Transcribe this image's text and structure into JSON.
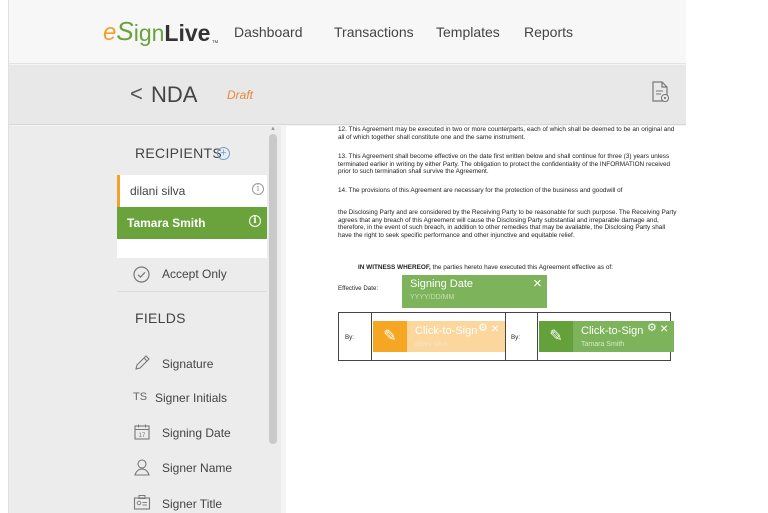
{
  "header": {
    "logo": {
      "e": "e",
      "s": "S",
      "ign": "ign",
      "live": "Live",
      "tm": "™"
    },
    "nav": [
      "Dashboard",
      "Transactions",
      "Templates",
      "Reports"
    ]
  },
  "subheader": {
    "back_symbol": "<",
    "title": "NDA",
    "status": "Draft"
  },
  "sidebar": {
    "recipients_title": "RECIPIENTS",
    "recipients": [
      {
        "name": "dilani silva",
        "color": "#f0a12b"
      },
      {
        "name": "Tamara Smith",
        "color": "#6aa33c"
      }
    ],
    "info_glyph": "i",
    "accept_only_label": "Accept Only",
    "fields_title": "FIELDS",
    "fields": [
      {
        "label": "Signature",
        "icon": "pen-icon"
      },
      {
        "label": "Signer Initials",
        "icon": "TS"
      },
      {
        "label": "Signing Date",
        "icon": "calendar-icon"
      },
      {
        "label": "Signer Name",
        "icon": "person-icon"
      },
      {
        "label": "Signer Title",
        "icon": "title-card-icon"
      }
    ]
  },
  "document": {
    "paragraphs": [
      "12.      This Agreement may be executed in two or more counterparts, each of which shall be deemed to be an original and all of which together shall constitute one and the same instrument.",
      "13.      This Agreement shall become effective on the date first written below and shall continue for three (3) years unless terminated earlier in writing by either Party. The obligation to protect the confidentiality of the INFORMATION received prior to such termination shall survive the Agreement.",
      "14.      The provisions of this Agreement are necessary for the protection of the business and goodwill of",
      "the Disclosing Party and are considered by the Receiving Party to be reasonable for such purpose. The Receiving Party agrees that any breach of this Agreement will cause the Disclosing Party substantial and irreparable damage and, therefore, in the event of such breach, in addition to other remedies that may be available, the Disclosing Party shall have the right to seek specific performance and other injunctive and equitable relief."
    ],
    "witness_bold": "IN WITNESS WHEREOF,",
    "witness_rest": " the parties hereto have executed this Agreement effective as of:",
    "effective_date_label": "Effective Date:",
    "date_field": {
      "title": "Signing Date",
      "placeholder": "YYYY/DD/MM"
    },
    "by_label": "By:",
    "signature_fields": [
      {
        "title": "Click-to-Sign",
        "signer": "dilani silva"
      },
      {
        "title": "Click-to-Sign",
        "signer": "Tamara Smith"
      }
    ],
    "close_glyph": "×",
    "gear_glyph": "⚙"
  },
  "colors": {
    "accent_green": "#6aa33c",
    "accent_orange": "#f0a12b",
    "draft": "#e8893a"
  }
}
